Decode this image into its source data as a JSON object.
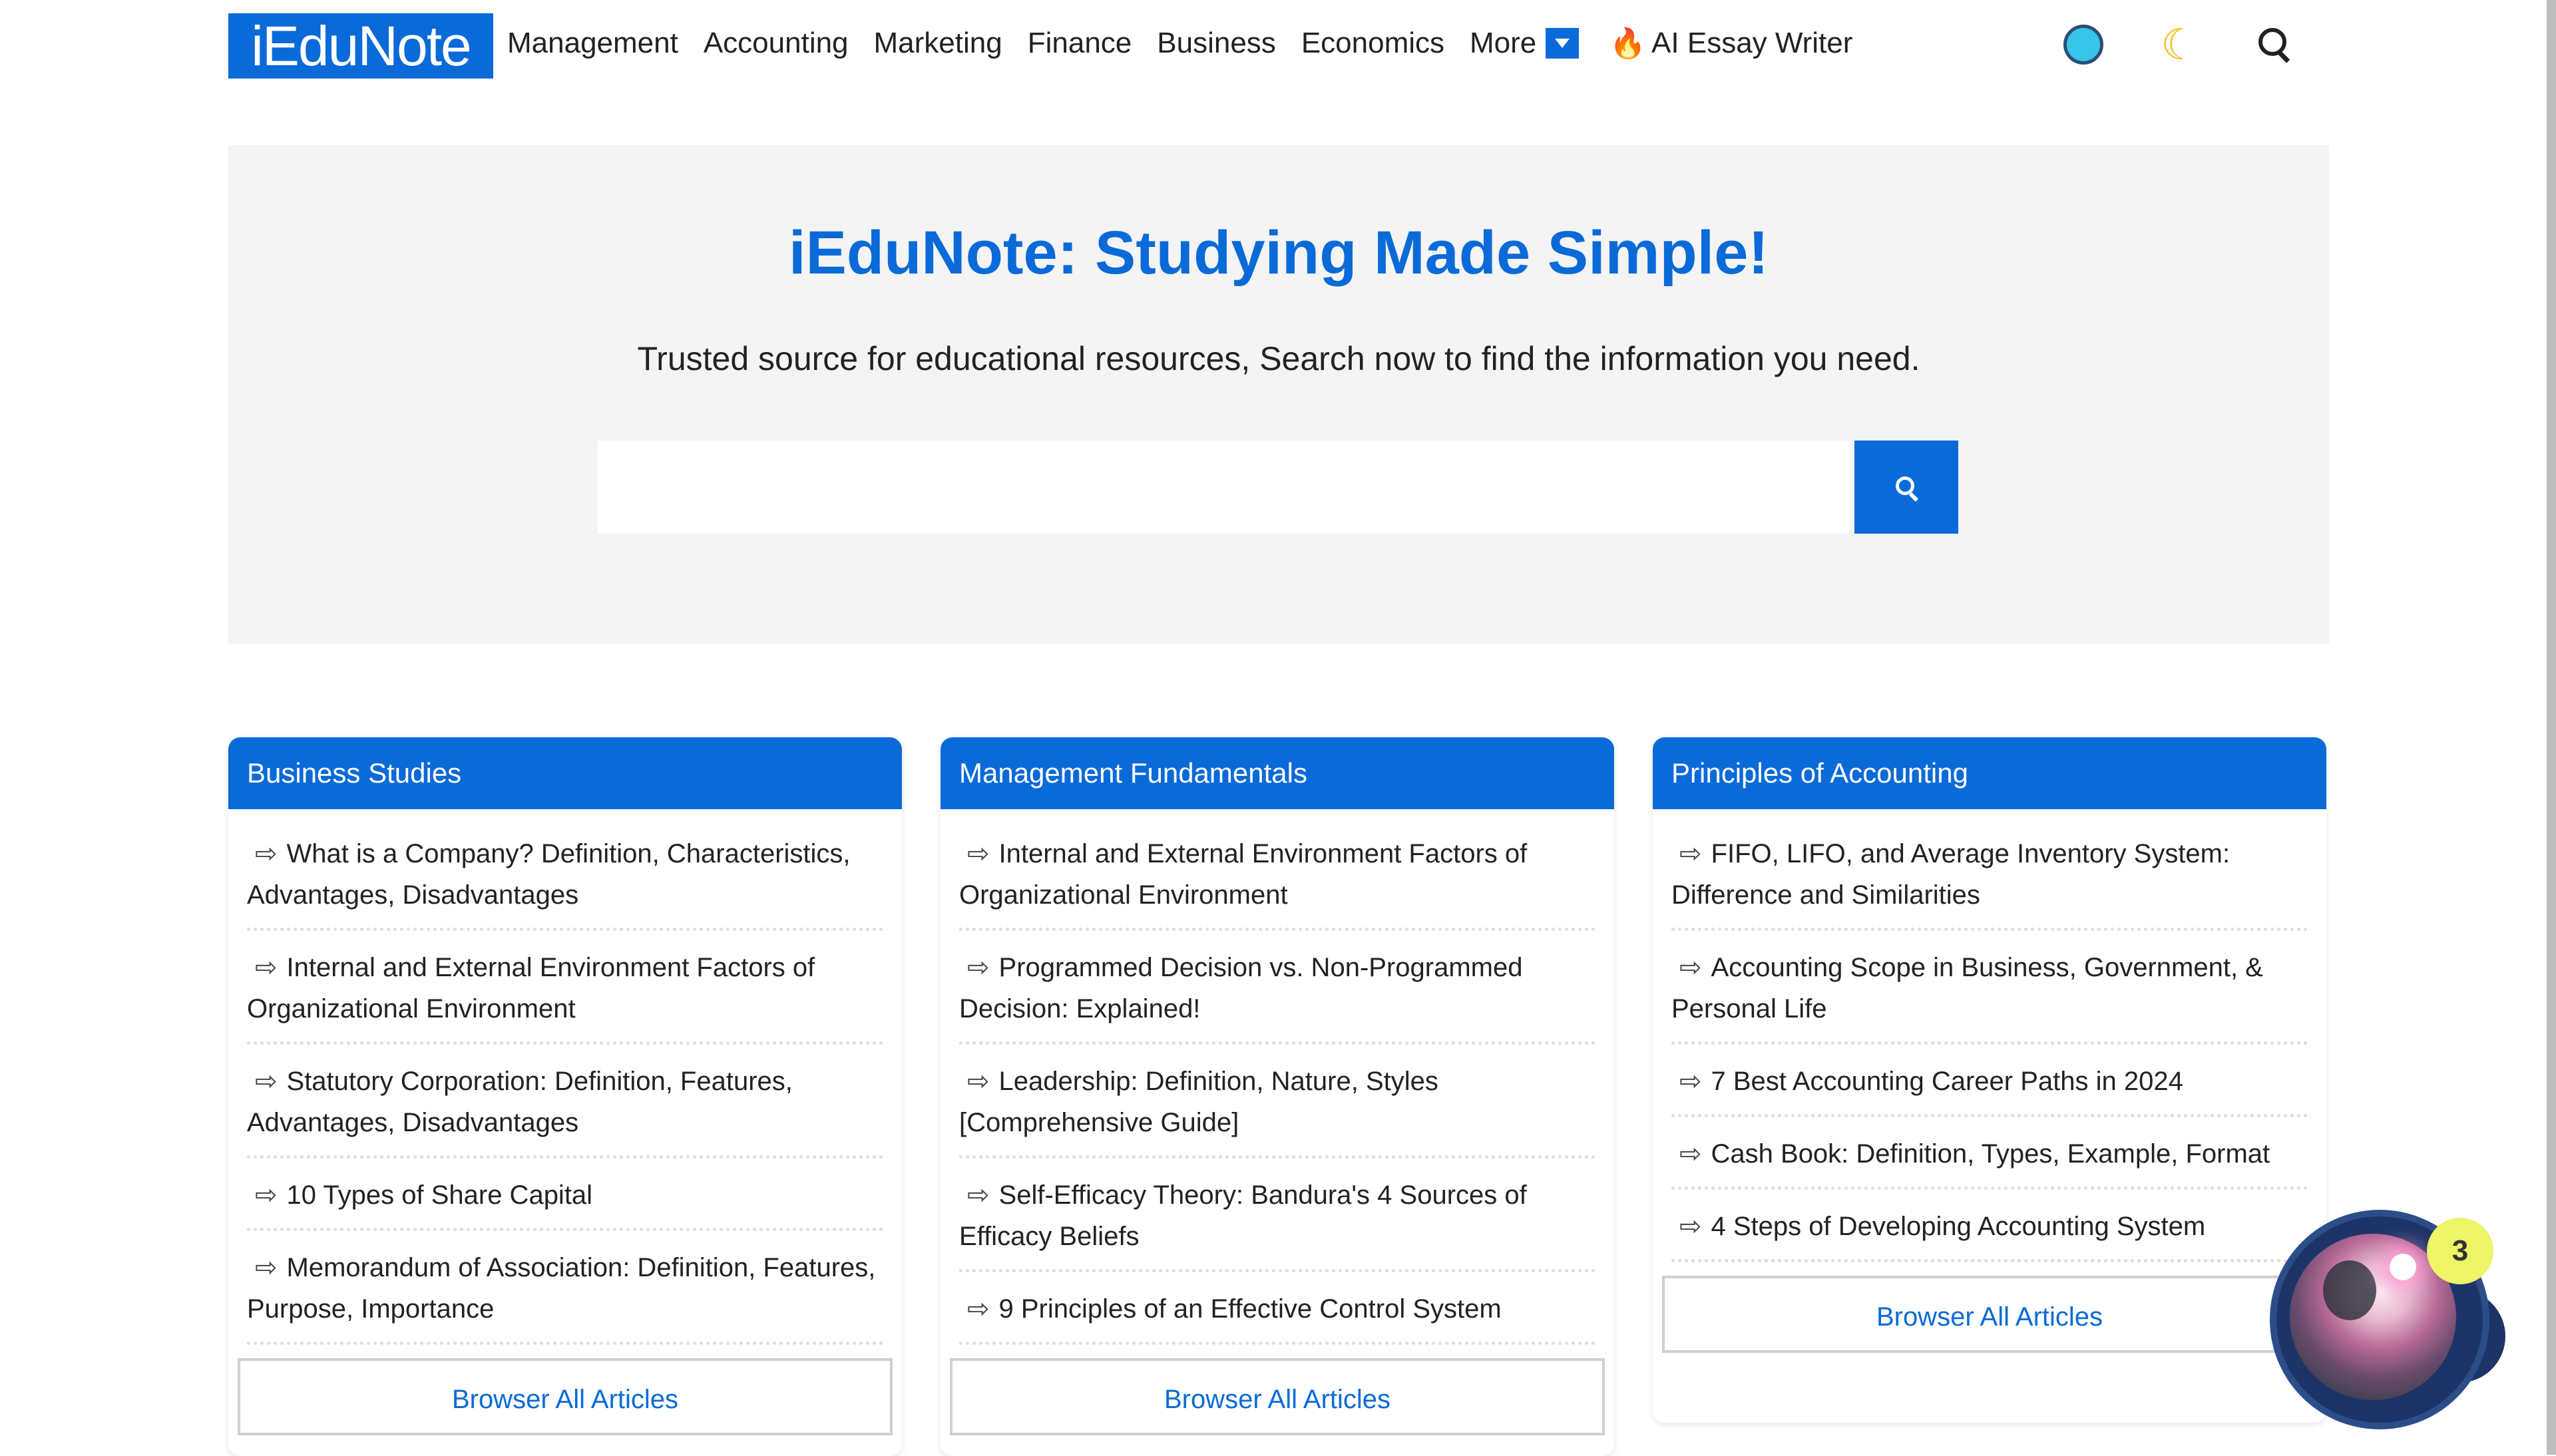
{
  "header": {
    "logo": "iEduNote",
    "nav": [
      "Management",
      "Accounting",
      "Marketing",
      "Finance",
      "Business",
      "Economics"
    ],
    "more_label": "More",
    "ai_writer_label": "AI Essay Writer",
    "icons": [
      "circle-icon",
      "moon-icon",
      "search-icon"
    ]
  },
  "hero": {
    "title": "iEduNote: Studying Made Simple!",
    "subtitle": "Trusted source for educational resources, Search now to find the information you need.",
    "search_placeholder": ""
  },
  "cards": [
    {
      "title": "Business Studies",
      "items": [
        "What is a Company? Definition, Characteristics, Advantages, Disadvantages",
        "Internal and External Environment Factors of Organizational Environment",
        "Statutory Corporation: Definition, Features, Advantages, Disadvantages",
        "10 Types of Share Capital",
        "Memorandum of Association: Definition, Features, Purpose, Importance"
      ],
      "button": "Browser All Articles"
    },
    {
      "title": "Management Fundamentals",
      "items": [
        "Internal and External Environment Factors of Organizational Environment",
        "Programmed Decision vs. Non-Programmed Decision: Explained!",
        "Leadership: Definition, Nature, Styles [Comprehensive Guide]",
        "Self-Efficacy Theory: Bandura's 4 Sources of Efficacy Beliefs",
        "9 Principles of an Effective Control System"
      ],
      "button": "Browser All Articles"
    },
    {
      "title": "Principles of Accounting",
      "items": [
        "FIFO, LIFO, and Average Inventory System: Difference and Similarities",
        "Accounting Scope in Business, Government, & Personal Life",
        "7 Best Accounting Career Paths in 2024",
        "Cash Book: Definition, Types, Example, Format",
        "4 Steps of Developing Accounting System"
      ],
      "button": "Browser All Articles"
    }
  ],
  "chat_widget": {
    "badge_count": "3"
  },
  "colors": {
    "brand": "#0a6ad8",
    "hero_bg": "#f4f4f4"
  }
}
